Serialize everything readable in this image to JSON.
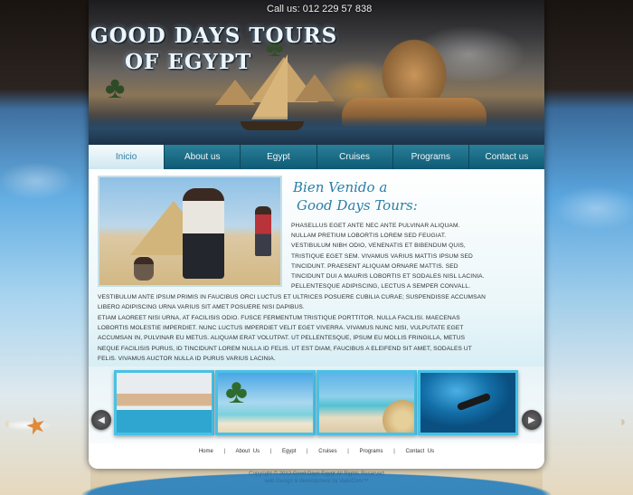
{
  "header": {
    "phone": "Call us: 012 229 57 838",
    "logo_line1": "GOOD DAYS TOURS",
    "logo_line2": "OF EGYPT"
  },
  "nav": {
    "items": [
      "Inicio",
      "About us",
      "Egypt",
      "Cruises",
      "Programs",
      "Contact us"
    ],
    "active": "Inicio"
  },
  "content": {
    "welcome_line1": "Bien Venido a",
    "welcome_line2": "Good Days Tours:",
    "intro": "PHASELLUS EGET ANTE NEC ANTE PULVINAR ALIQUAM. NULLAM PRETIUM LOBORTIS LOREM SED FEUGIAT. VESTIBULUM NIBH ODIO, VENENATIS ET BIBENDUM QUIS, TRISTIQUE EGET SEM. VIVAMUS VARIUS MATTIS IPSUM SED TINCIDUNT. PRAESENT ALIQUAM ORNARE MATTIS. SED TINCIDUNT DUI A MAURIS LOBORTIS ET SODALES NISL LACINIA. PELLENTESQUE ADIPISCING, LECTUS A SEMPER CONVALL.",
    "paragraph1": "VESTIBULUM ANTE IPSUM PRIMIS IN FAUCIBUS ORCI LUCTUS ET ULTRICES POSUERE CUBILIA CURAE; SUSPENDISSE ACCUMSAN LIBERO ADIPISCING URNA VARIUS SIT AMET POSUERE NISI DAPIBUS.",
    "paragraph2": "ETIAM LAOREET NISI URNA, AT FACILISIS ODIO. FUSCE FERMENTUM TRISTIQUE PORTTITOR. NULLA FACILISI. MAECENAS LOBORTIS MOLESTIE IMPERDIET. NUNC LUCTUS IMPERDIET VELIT EGET VIVERRA. VIVAMUS NUNC NISI, VULPUTATE EGET ACCUMSAN IN, PULVINAR EU METUS. ALIQUAM ERAT VOLUTPAT. UT PELLENTESQUE, IPSUM EU MOLLIS FRINGILLA, METUS NEQUE FACILISIS PURUS, ID TINCIDUNT LOREM NULLA ID FELIS. UT EST DIAM, FAUCIBUS A ELEIFEND SIT AMET, SODALES UT FELIS. VIVAMUS AUCTOR NULLA ID PURUS VARIUS LACINIA."
  },
  "gallery": {
    "prev_icon": "chevron-left-icon",
    "next_icon": "chevron-right-icon",
    "prev_glyph": "◀",
    "next_glyph": "▶"
  },
  "footer": {
    "links": [
      "Home",
      "About Us",
      "Egypt",
      "Cruises",
      "Programs",
      "Contact Us"
    ],
    "separator": "|",
    "copyright": "Copyright © 2012 Good Days Egypt All Rights Reserved",
    "credit": "web Design & development by VadeCom™"
  },
  "colors": {
    "accent": "#2b7ea6",
    "nav_bg": "#0f5a74",
    "thumb_border": "#48c1e6"
  }
}
